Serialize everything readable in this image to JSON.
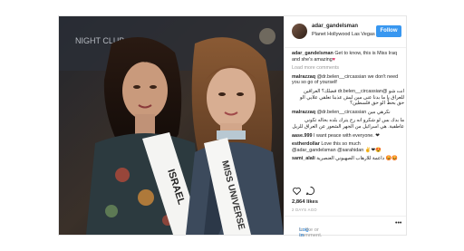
{
  "post": {
    "photo_sign_text": "NIGHT CLUB",
    "sash_left_text": "ISRAEL",
    "sash_right_text": "MISS UNIVERSE",
    "header": {
      "username": "adar_gandelsman",
      "location": "Planet Hollywood Las Vegas",
      "follow_label": "Follow",
      "more_icon": "•••"
    },
    "caption": {
      "user": "adar_gandelsman",
      "text": "Get to know, this is Miss Iraq and she's amazing",
      "emoji": "♥"
    },
    "load_more_label": "Load more comments",
    "comments": [
      {
        "user": "malrazzaq",
        "text": "@dr.belen__circassian we don't need you so go of yourself",
        "rtl": false
      },
      {
        "user": "",
        "text": "انت شو @dr.belen__circassian فضلك؟ العراقين للعراق يا ما بدنا عنى مين ليش عذبنا تعلقي علايي الو حق بحطّ الو حق فلسطين؟",
        "rtl": true
      },
      {
        "user": "malrazzaq",
        "text": "@dr.belen__circassian نكرهي مين",
        "rtl": false
      },
      {
        "user": "",
        "text": "ما بدك بس لو شكرو انه رح يترك بلده بحاله تكوني عاطفية. هي اسرائيل من الجهر الشعور عن العراق للريل",
        "rtl": true
      },
      {
        "user": "aase.999",
        "text": "I want peace with everyone. ❤",
        "rtl": false
      },
      {
        "user": "estherdollar",
        "text": "Love this so much @adar_gandelsman @sarahidan ✌❤😍",
        "rtl": false
      },
      {
        "user": "sami_alali",
        "text": "داعمة للارهاب الصهيوني العنصرية 😡😡",
        "rtl": false
      }
    ],
    "likes_label": "2,864 likes",
    "time_ago": "2 DAYS AGO",
    "login_link": "Log in",
    "login_rest": " to like or comment."
  }
}
